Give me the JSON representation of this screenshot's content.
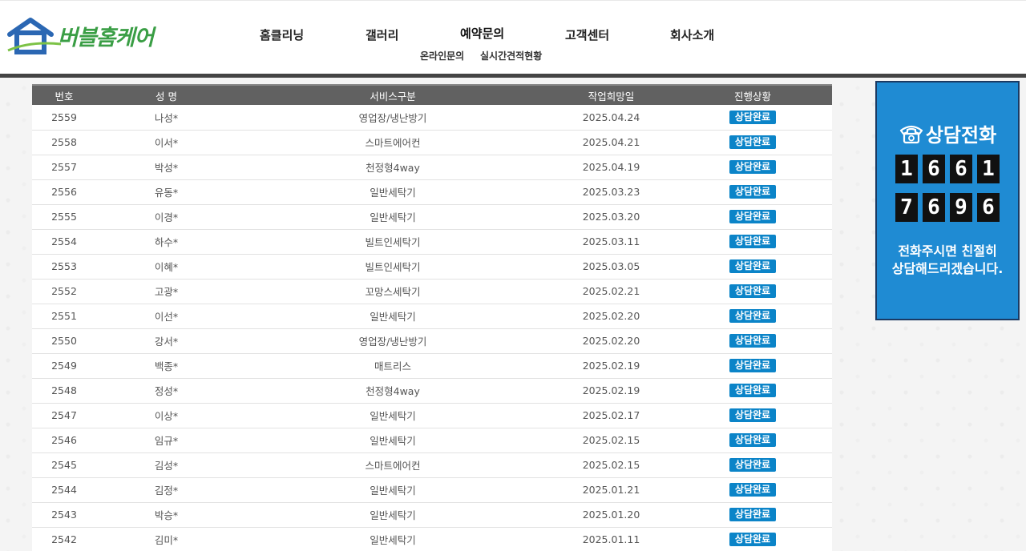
{
  "logo": {
    "text": "버블홈케어"
  },
  "nav": {
    "items": [
      {
        "label": "홈클리닝"
      },
      {
        "label": "갤러리"
      },
      {
        "label": "예약문의"
      },
      {
        "label": "고객센터"
      },
      {
        "label": "회사소개"
      }
    ],
    "subitems": [
      {
        "label": "온라인문의"
      },
      {
        "label": "실시간견적현황"
      }
    ]
  },
  "table": {
    "headers": [
      "번호",
      "성 명",
      "서비스구분",
      "작업희망일",
      "진행상황"
    ],
    "rows": [
      {
        "no": "2559",
        "name": "나성*",
        "service": "영업장/냉난방기",
        "date": "2025.04.24",
        "status": "상담완료"
      },
      {
        "no": "2558",
        "name": "이서*",
        "service": "스마트에어컨",
        "date": "2025.04.21",
        "status": "상담완료"
      },
      {
        "no": "2557",
        "name": "박성*",
        "service": "천정형4way",
        "date": "2025.04.19",
        "status": "상담완료"
      },
      {
        "no": "2556",
        "name": "유동*",
        "service": "일반세탁기",
        "date": "2025.03.23",
        "status": "상담완료"
      },
      {
        "no": "2555",
        "name": "이경*",
        "service": "일반세탁기",
        "date": "2025.03.20",
        "status": "상담완료"
      },
      {
        "no": "2554",
        "name": "하수*",
        "service": "빌트인세탁기",
        "date": "2025.03.11",
        "status": "상담완료"
      },
      {
        "no": "2553",
        "name": "이혜*",
        "service": "빌트인세탁기",
        "date": "2025.03.05",
        "status": "상담완료"
      },
      {
        "no": "2552",
        "name": "고광*",
        "service": "꼬망스세탁기",
        "date": "2025.02.21",
        "status": "상담완료"
      },
      {
        "no": "2551",
        "name": "이선*",
        "service": "일반세탁기",
        "date": "2025.02.20",
        "status": "상담완료"
      },
      {
        "no": "2550",
        "name": "강서*",
        "service": "영업장/냉난방기",
        "date": "2025.02.20",
        "status": "상담완료"
      },
      {
        "no": "2549",
        "name": "백종*",
        "service": "매트리스",
        "date": "2025.02.19",
        "status": "상담완료"
      },
      {
        "no": "2548",
        "name": "정성*",
        "service": "천정형4way",
        "date": "2025.02.19",
        "status": "상담완료"
      },
      {
        "no": "2547",
        "name": "이상*",
        "service": "일반세탁기",
        "date": "2025.02.17",
        "status": "상담완료"
      },
      {
        "no": "2546",
        "name": "임규*",
        "service": "일반세탁기",
        "date": "2025.02.15",
        "status": "상담완료"
      },
      {
        "no": "2545",
        "name": "김성*",
        "service": "스마트에어컨",
        "date": "2025.02.15",
        "status": "상담완료"
      },
      {
        "no": "2544",
        "name": "김정*",
        "service": "일반세탁기",
        "date": "2025.01.21",
        "status": "상담완료"
      },
      {
        "no": "2543",
        "name": "박승*",
        "service": "일반세탁기",
        "date": "2025.01.20",
        "status": "상담완료"
      },
      {
        "no": "2542",
        "name": "김미*",
        "service": "일반세탁기",
        "date": "2025.01.11",
        "status": "상담완료"
      }
    ]
  },
  "banner": {
    "title": "상담전화",
    "phone_line1": [
      "1",
      "6",
      "6",
      "1"
    ],
    "phone_line2": [
      "7",
      "6",
      "9",
      "6"
    ],
    "desc_line1": "전화주시면 친절히",
    "desc_line2": "상담해드리겠습니다.",
    "icon": "telephone-icon"
  },
  "colors": {
    "badge": "#0b84c8",
    "header_row": "#616161",
    "banner_bg": "#1f8bd3",
    "logo_green": "#3a9e45",
    "logo_blue": "#2b67b3"
  }
}
